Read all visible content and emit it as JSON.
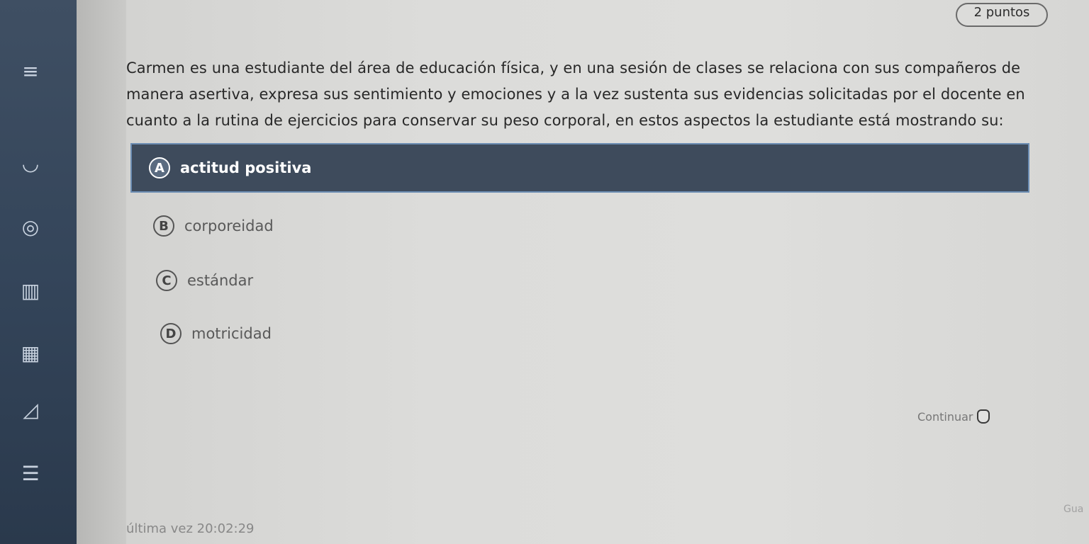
{
  "points": "2 puntos",
  "question": "Carmen es una estudiante del área de educación física, y en una sesión de clases se relaciona con sus compañeros de manera asertiva, expresa sus sentimiento y emociones y a la vez sustenta sus evidencias solicitadas por el docente en cuanto a la rutina de ejercicios para conservar su peso corporal, en estos aspectos la estudiante está mostrando su:",
  "options": [
    {
      "letter": "A",
      "label": "actitud positiva"
    },
    {
      "letter": "B",
      "label": "corporeidad"
    },
    {
      "letter": "C",
      "label": "estándar"
    },
    {
      "letter": "D",
      "label": "motricidad"
    }
  ],
  "continue_label": "Continuar",
  "save_label": "última vez 20:02:29",
  "right_hint": "Gua",
  "colors": {
    "selected_bg": "#3e4b5c",
    "selected_border": "#6c8db3",
    "rail": "#34455a"
  }
}
